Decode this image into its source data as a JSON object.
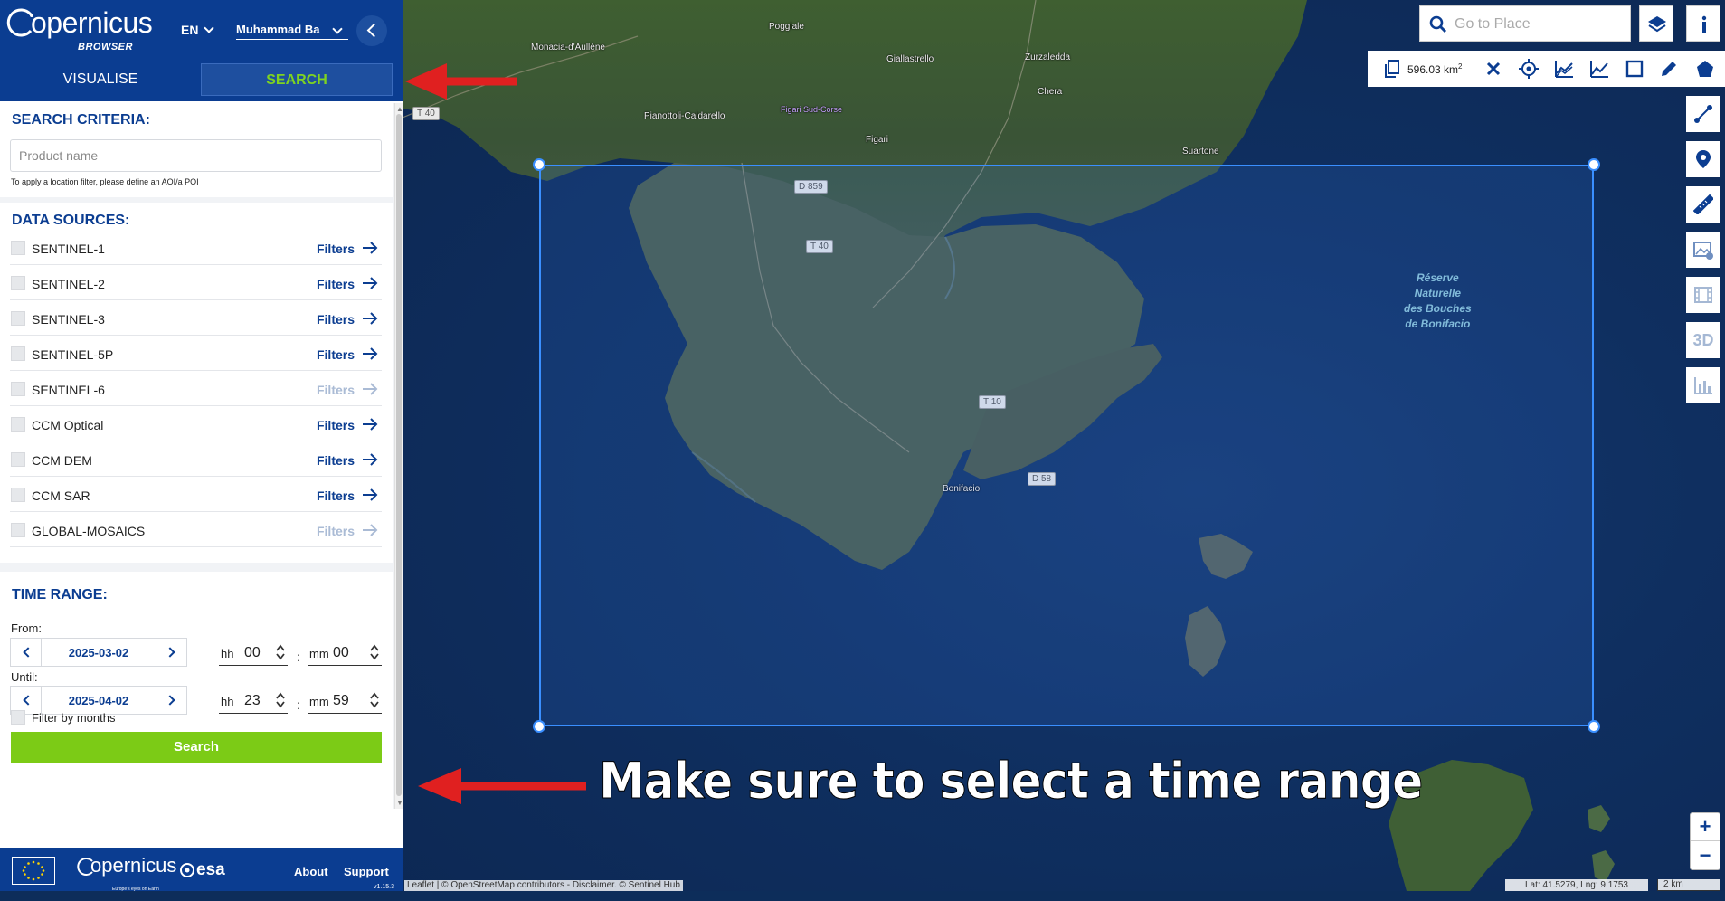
{
  "header": {
    "logo_name": "opernicus",
    "logo_sub": "BROWSER",
    "language": "EN",
    "user": "Muhammad Ba"
  },
  "tabs": {
    "visualise": "VISUALISE",
    "search": "SEARCH"
  },
  "search_criteria": {
    "title": "SEARCH CRITERIA:",
    "product_placeholder": "Product name",
    "hint": "To apply a location filter, please define an AOI/a POI"
  },
  "data_sources": {
    "title": "DATA SOURCES:",
    "filters_label": "Filters",
    "items": [
      {
        "label": "SENTINEL-1",
        "enabled": true
      },
      {
        "label": "SENTINEL-2",
        "enabled": true
      },
      {
        "label": "SENTINEL-3",
        "enabled": true
      },
      {
        "label": "SENTINEL-5P",
        "enabled": true
      },
      {
        "label": "SENTINEL-6",
        "enabled": false
      },
      {
        "label": "CCM Optical",
        "enabled": true
      },
      {
        "label": "CCM DEM",
        "enabled": true
      },
      {
        "label": "CCM SAR",
        "enabled": true
      },
      {
        "label": "GLOBAL-MOSAICS",
        "enabled": false
      }
    ]
  },
  "time_range": {
    "title": "TIME RANGE:",
    "from_label": "From:",
    "until_label": "Until:",
    "from_date": "2025-03-02",
    "from_hh": "00",
    "from_mm": "00",
    "until_date": "2025-04-02",
    "until_hh": "23",
    "until_mm": "59",
    "hh_label": "hh",
    "mm_label": "mm",
    "colon": ":",
    "filter_months": "Filter by months",
    "search_button": "Search"
  },
  "footer": {
    "copernicus": "opernicus",
    "copernicus_tag": "Europe's eyes on Earth",
    "esa": "esa",
    "about": "About",
    "support": "Support",
    "version": "v1.15.3"
  },
  "map": {
    "goto_placeholder": "Go to Place",
    "aoi_area": "596.03 km",
    "aoi_area_unit_sup": "2",
    "labels": {
      "poggiale": "Poggiale",
      "monacia": "Monacia-d'Aullène",
      "giallastrello": "Giallastrello",
      "zurzaledda": "Zurzaledda",
      "chera": "Chera",
      "pianottoli": "Pianottoli-Caldarello",
      "figari": "Figari",
      "suartone": "Suartone",
      "bonifacio": "Bonifacio",
      "figari_airport": "Figari Sud-Corse"
    },
    "roads": {
      "t40_a": "T 40",
      "d859": "D 859",
      "t40_b": "T 40",
      "t10": "T 10",
      "d58": "D 58"
    },
    "reserve": [
      "Réserve",
      "Naturelle",
      "des Bouches",
      "de Bonifacio"
    ],
    "tool_3d": "3D",
    "zoom_in": "+",
    "zoom_out": "−",
    "attribution": "Leaflet | © OpenStreetMap contributors - Disclaimer. © Sentinel Hub",
    "coords": "Lat: 41.5279, Lng: 9.1753",
    "scale": "2 km"
  },
  "annotations": {
    "time_range_note": "Make sure to select a time range",
    "arrow_color": "#e02020"
  },
  "colors": {
    "brand_blue": "#0b3d91",
    "search_green": "#7ccb16",
    "aoi_blue": "#3a8fff"
  }
}
